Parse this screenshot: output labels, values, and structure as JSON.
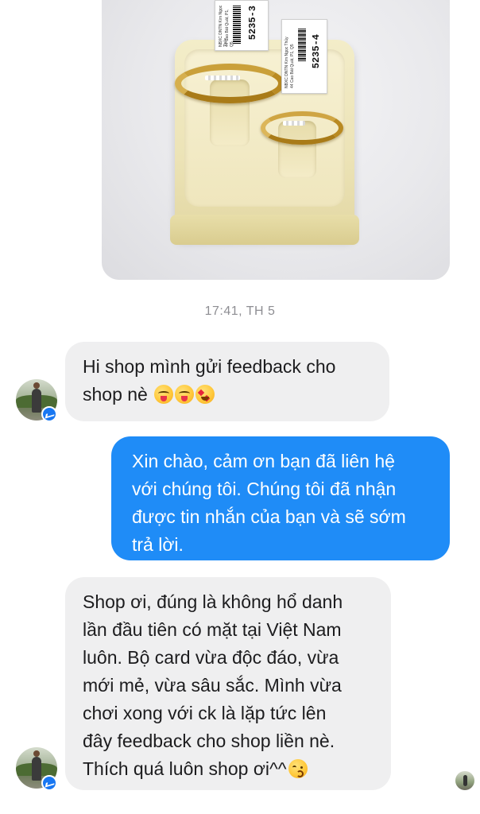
{
  "photo": {
    "tag1_code": "5235-3",
    "tag2_code": "5235-4"
  },
  "timestamp": "17:41, TH 5",
  "messages": [
    {
      "direction": "incoming",
      "lines": [
        "Hi shop mình gửi feedback  cho",
        "shop nè"
      ],
      "emojis": [
        "squinting-tongue-emoji",
        "squinting-tongue-emoji",
        "heart-eyes-emoji"
      ]
    },
    {
      "direction": "outgoing",
      "lines": [
        "Xin chào, cảm ơn bạn đã liên hệ",
        "với chúng tôi. Chúng tôi đã nhận",
        "được tin nhắn của bạn và sẽ sớm",
        "trả lời."
      ]
    },
    {
      "direction": "incoming",
      "lines": [
        "Shop ơi, đúng là không hổ danh",
        "lần đầu tiên có mặt tại Việt Nam",
        "luôn. Bộ card vừa độc đáo, vừa",
        "mới mẻ, vừa sâu sắc. Mình vừa",
        "chơi xong với ck là lặp tức lên",
        "đây feedback cho shop liền nè.",
        "Thích quá luôn shop ơi^^"
      ],
      "emojis": [
        "kissing-emoji"
      ]
    }
  ],
  "colors": {
    "incoming_bubble": "#efeff0",
    "outgoing_bubble": "#1f8cf7",
    "timestamp": "#8e8e93",
    "messenger_badge": "#1877f2"
  }
}
